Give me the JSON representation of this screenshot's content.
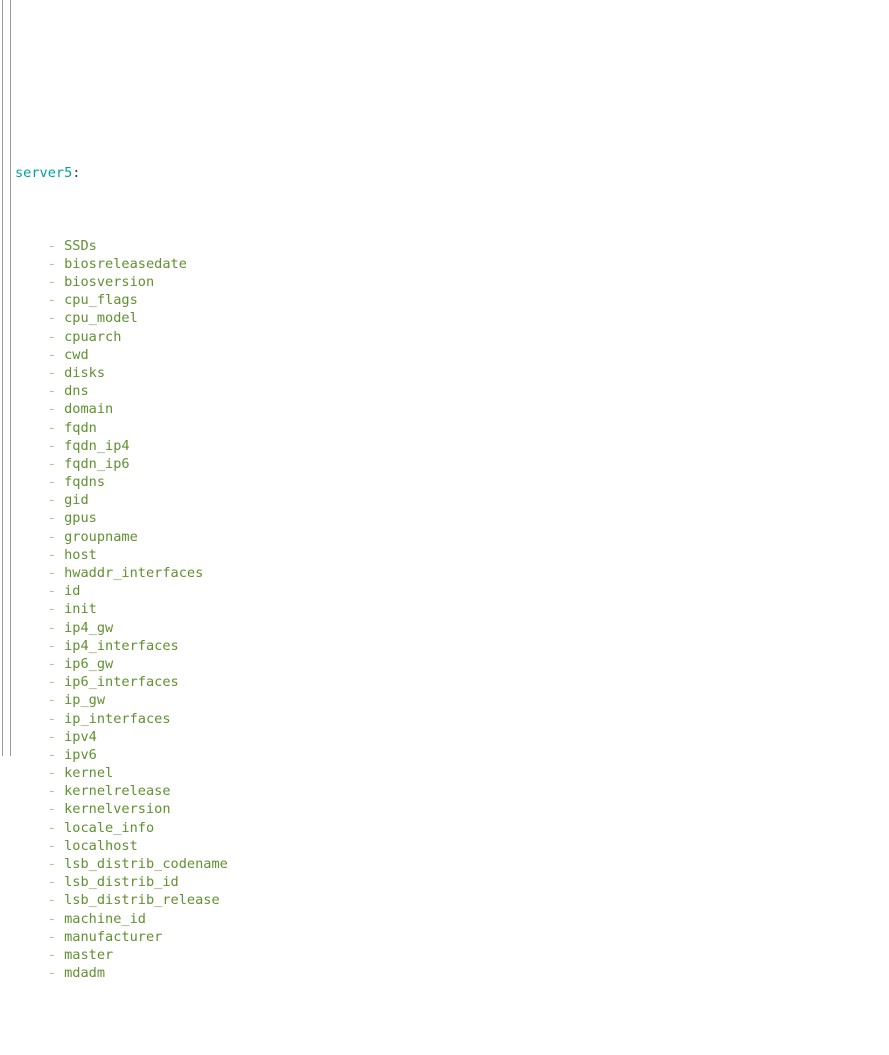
{
  "output": {
    "root_key": "server5",
    "key_separator": ":",
    "item_indent": "    ",
    "item_bullet": "- ",
    "colors": {
      "background": "#ffffff",
      "key": "#00a0a0",
      "colon": "#1c4b4b",
      "bullet": "#a3c97a",
      "value": "#5f9130",
      "gutter_rule": "#9a9a9a"
    },
    "items": [
      "SSDs",
      "biosreleasedate",
      "biosversion",
      "cpu_flags",
      "cpu_model",
      "cpuarch",
      "cwd",
      "disks",
      "dns",
      "domain",
      "fqdn",
      "fqdn_ip4",
      "fqdn_ip6",
      "fqdns",
      "gid",
      "gpus",
      "groupname",
      "host",
      "hwaddr_interfaces",
      "id",
      "init",
      "ip4_gw",
      "ip4_interfaces",
      "ip6_gw",
      "ip6_interfaces",
      "ip_gw",
      "ip_interfaces",
      "ipv4",
      "ipv6",
      "kernel",
      "kernelrelease",
      "kernelversion",
      "locale_info",
      "localhost",
      "lsb_distrib_codename",
      "lsb_distrib_id",
      "lsb_distrib_release",
      "machine_id",
      "manufacturer",
      "master",
      "mdadm"
    ]
  }
}
